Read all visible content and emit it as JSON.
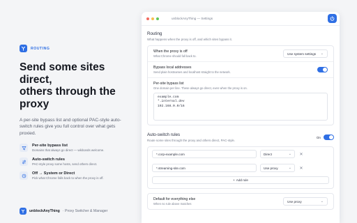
{
  "brand": {
    "badge": "ROUTING",
    "headline_lines": [
      "Send some sites",
      "direct,",
      "others through the",
      "proxy"
    ],
    "subtitle": "A per-site bypass list and optional PAC-style auto-switch rules give you full control over what gets proxied."
  },
  "features": [
    {
      "title": "Per-site bypass list",
      "desc": "Domains that always go direct — wildcards welcome.",
      "icon": "filter-icon"
    },
    {
      "title": "Auto-switch rules",
      "desc": "PAC-style proxy some hosts, send others direct.",
      "icon": "switch-icon"
    },
    {
      "title": "Off → System or Direct",
      "desc": "Pick what Chrome falls back to when the proxy is off.",
      "icon": "fallback-icon"
    }
  ],
  "footer": {
    "name": "unblockAnyThing",
    "tagline": "· Proxy Switcher & Manager"
  },
  "window": {
    "title": "unblockAnyThing — Settings"
  },
  "routing": {
    "title": "Routing",
    "desc": "What happens when the proxy is off, and which sites bypass it.",
    "proxy_off": {
      "label": "When the proxy is off",
      "sub": "What Chrome should fall back to.",
      "value": "Use system settings"
    },
    "bypass_local": {
      "label": "Bypass local addresses",
      "sub": "Send plain hostnames and localhost straight to the network.",
      "enabled": true
    },
    "per_site": {
      "label": "Per-site bypass list",
      "sub": "One domain per line. These always go direct, even when the proxy is on.",
      "lines": [
        "example.com",
        "*.internal.dev",
        "192.168.0.0/16"
      ]
    }
  },
  "auto_switch": {
    "title": "Auto-switch rules",
    "desc": "Route some sites through the proxy and others direct, PAC-style.",
    "status": "On",
    "enabled": true,
    "rules": [
      {
        "pattern": "*.corp-example.com",
        "action": "Direct"
      },
      {
        "pattern": "*.streaming-site.com",
        "action": "Use proxy"
      }
    ],
    "add_label": "Add rule",
    "default": {
      "label": "Default for everything else",
      "sub": "When no rule above matches",
      "value": "Use proxy"
    }
  },
  "colors": {
    "accent": "#2f6fe4",
    "dot_red": "#f26a5f",
    "dot_yellow": "#f5bf4f",
    "dot_green": "#5fc65b"
  }
}
